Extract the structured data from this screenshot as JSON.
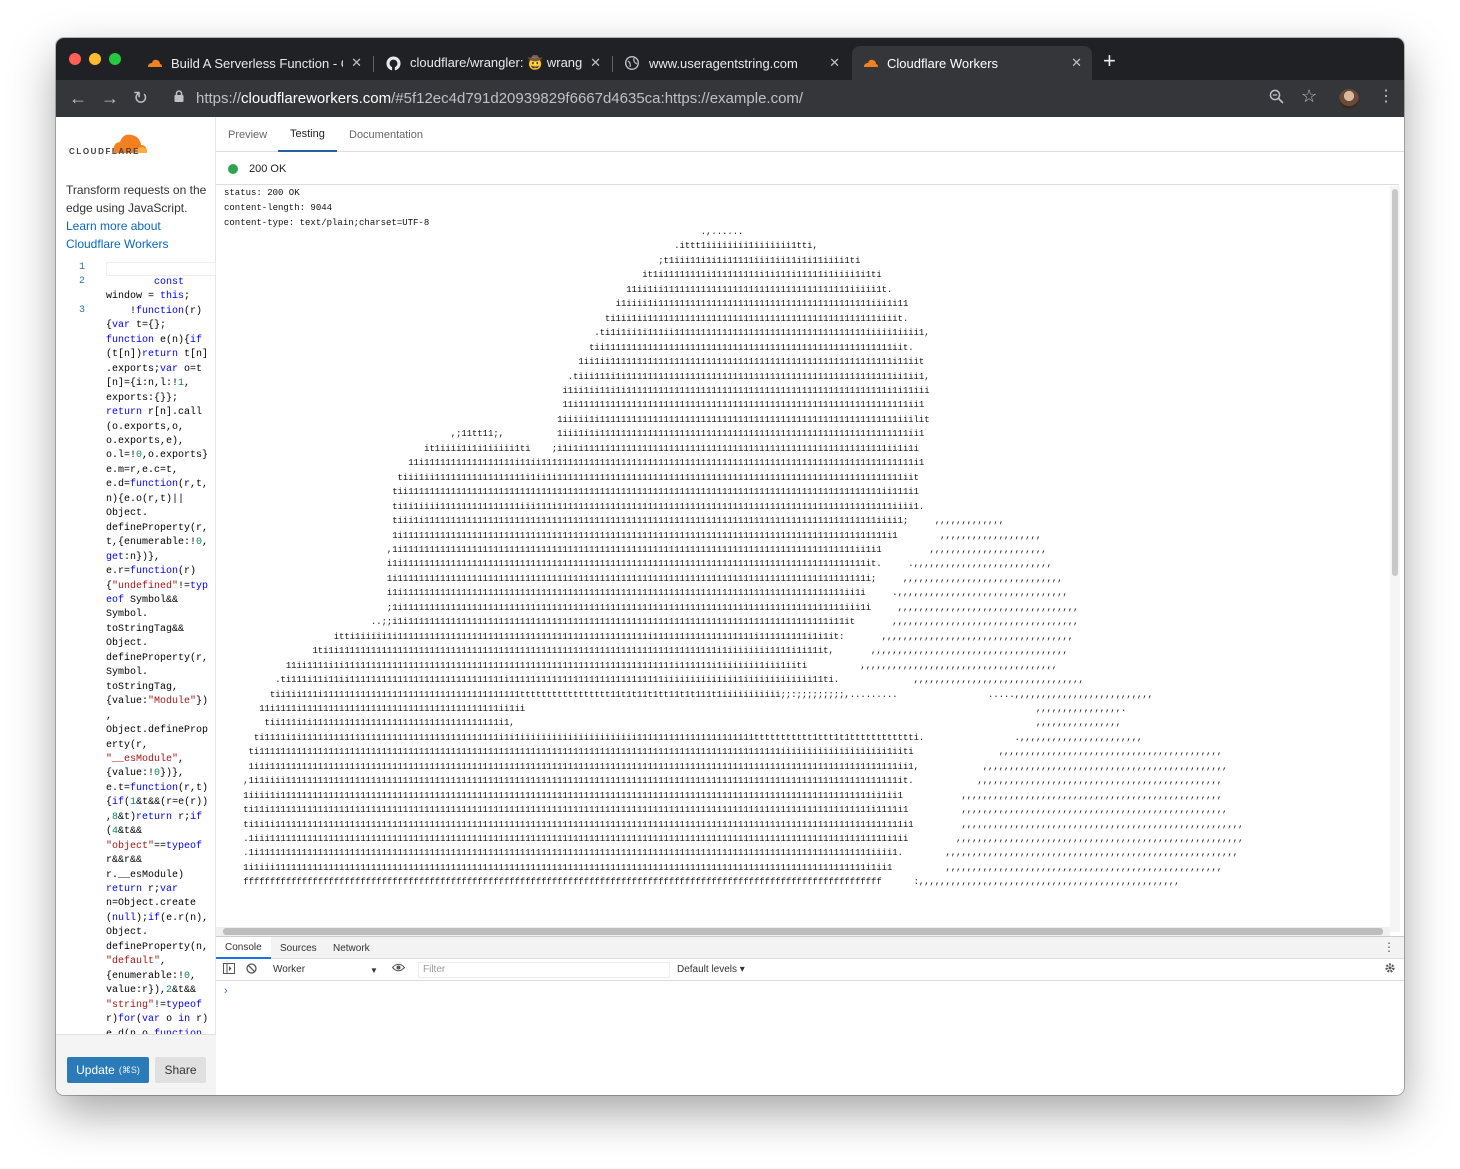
{
  "browser": {
    "tabs": [
      {
        "title": "Build A Serverless Function - C",
        "favicon": "cloudflare-icon"
      },
      {
        "title": "cloudflare/wrangler: 🤠 wrangl",
        "favicon": "github-icon"
      },
      {
        "title": "www.useragentstring.com",
        "favicon": "globe-icon"
      },
      {
        "title": "Cloudflare Workers",
        "favicon": "cloudflare-icon"
      }
    ],
    "url_prefix": "https://",
    "url_host": "cloudflareworkers.com",
    "url_rest": "/#5f12ec4d791d20939829f6667d4635ca:https://example.com/"
  },
  "sidebar": {
    "logo_text": "CLOUDFLARE",
    "description": "Transform requests on the edge using JavaScript.",
    "learn_more": "Learn more about Cloudflare Workers",
    "line_numbers": [
      "1",
      "2",
      "3"
    ],
    "update_label": "Update",
    "update_shortcut": "(⌘S)",
    "share_label": "Share"
  },
  "main": {
    "tabs": [
      "Preview",
      "Testing",
      "Documentation"
    ],
    "active_tab": "Testing",
    "status_text": "200 OK",
    "status_color": "#2ea44f",
    "headers": "status: 200 OK\ncontent-length: 9044\ncontent-type: text/plain;charset=UTF-8"
  },
  "devtools": {
    "tabs": [
      "Console",
      "Sources",
      "Network"
    ],
    "context": "Worker",
    "filter_placeholder": "Filter",
    "levels": "Default levels ▾",
    "prompt": "›"
  },
  "colors": {
    "accent": "#2b7bb9",
    "cloudflare_orange": "#f38020",
    "link": "#0a67c2"
  }
}
